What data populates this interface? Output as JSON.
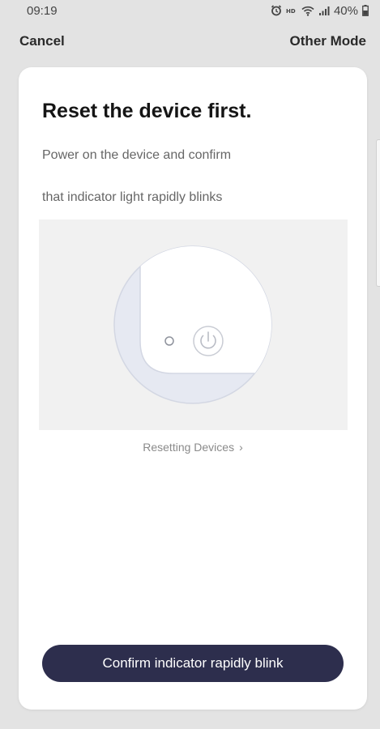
{
  "status_bar": {
    "time": "09:19",
    "battery": "40%",
    "icons": [
      "alarm-icon",
      "hd-icon",
      "wifi-icon",
      "signal-icon",
      "battery-icon"
    ]
  },
  "nav": {
    "cancel_label": "Cancel",
    "other_mode_label": "Other Mode"
  },
  "content": {
    "title": "Reset the device first.",
    "description_line1": "Power on the device and confirm",
    "description_line2": "that indicator light rapidly blinks",
    "reset_link_label": "Resetting Devices",
    "reset_link_icon": "chevron-right-icon",
    "confirm_button_label": "Confirm indicator rapidly blink"
  },
  "colors": {
    "background": "#e3e3e3",
    "card": "#ffffff",
    "button": "#2d2e4d",
    "illustration_bg": "#f1f1f1"
  }
}
